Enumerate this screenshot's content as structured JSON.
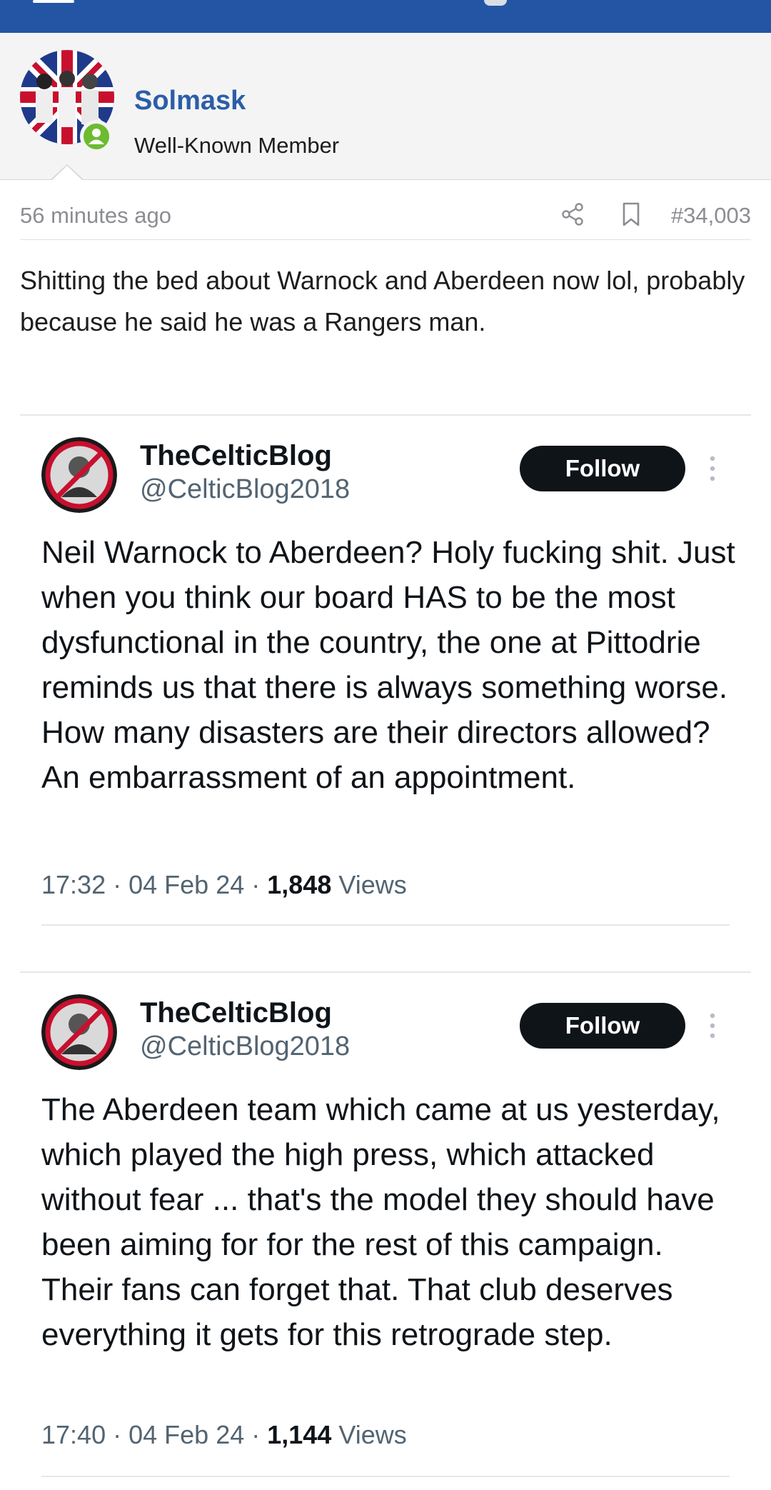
{
  "colors": {
    "topbar": "#2455a4",
    "username": "#2b5ea7",
    "online_badge": "#6dbb2f",
    "follow_button": "#0f1419"
  },
  "post": {
    "author": {
      "name": "Solmask",
      "title": "Well-Known Member",
      "avatar_icon": "avatar-union-jack",
      "online_icon": "user-online-icon"
    },
    "time": "56 minutes ago",
    "share_icon": "share-icon",
    "bookmark_icon": "bookmark-icon",
    "number": "#34,003",
    "body": "Shitting the bed about Warnock and Aberdeen now lol, probably because he said he was a Rangers man."
  },
  "embeds": [
    {
      "name": "TheCelticBlog",
      "handle": "@CelticBlog2018",
      "follow_label": "Follow",
      "text": "Neil Warnock to Aberdeen? Holy fucking shit. Just when you think our board HAS to be the most dysfunctional in the country, the one at Pittodrie reminds us that there is always something worse. How many disasters are their directors allowed? An embarrassment of an appointment.",
      "time": "17:32",
      "date": "04 Feb 24",
      "views": "1,848",
      "views_label": "Views"
    },
    {
      "name": "TheCelticBlog",
      "handle": "@CelticBlog2018",
      "follow_label": "Follow",
      "text": "The Aberdeen team which came at us yesterday, which played the high press, which attacked without fear ... that's the model they should have been aiming for for the rest of this campaign. Their fans can forget that. That club deserves everything it gets for this retrograde step.",
      "time": "17:40",
      "date": "04 Feb 24",
      "views": "1,144",
      "views_label": "Views"
    }
  ]
}
